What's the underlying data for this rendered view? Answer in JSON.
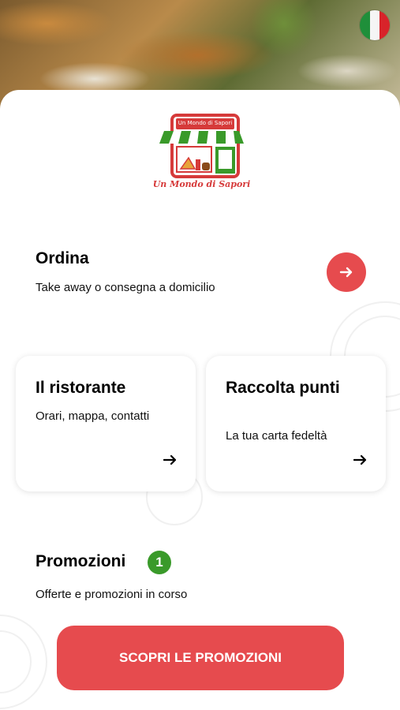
{
  "header": {
    "language_flag_icon": "italy-flag-icon"
  },
  "brand": {
    "logo_top_text": "Un Mondo di Sapori",
    "logo_text": "Un Mondo di Sapori",
    "accent": "#e64b4e"
  },
  "ordina": {
    "title": "Ordina",
    "subtitle": "Take away o consegna a domicilio",
    "button_icon": "arrow-right-icon"
  },
  "cards": [
    {
      "title": "Il ristorante",
      "subtitle": "Orari, mappa, contatti",
      "icon": "arrow-right-icon"
    },
    {
      "title": "Raccolta punti",
      "subtitle": "La tua carta fedeltà",
      "icon": "arrow-right-icon"
    }
  ],
  "promozioni": {
    "title": "Promozioni",
    "badge_count": "1",
    "badge_color": "#3a9a2a",
    "subtitle": "Offerte e promozioni in corso",
    "cta_label": "SCOPRI LE PROMOZIONI"
  }
}
